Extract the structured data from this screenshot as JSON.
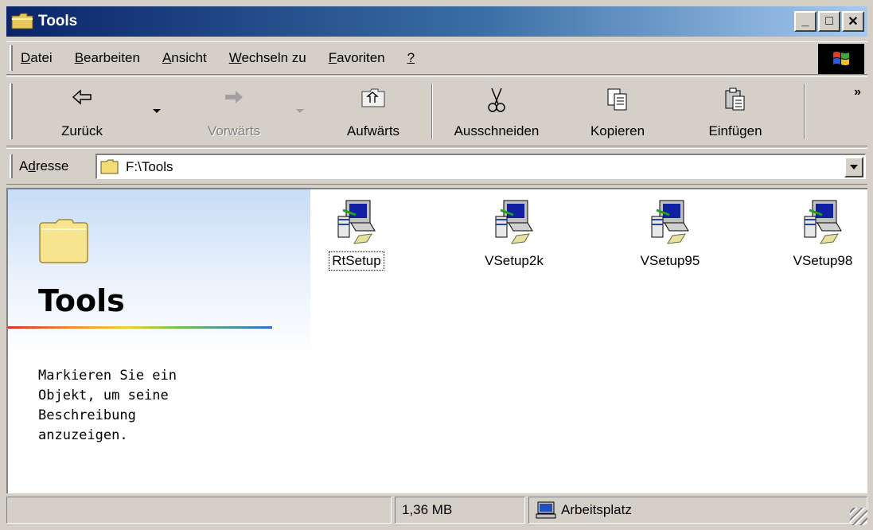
{
  "window": {
    "title": "Tools",
    "minimize": "_",
    "maximize": "□",
    "close": "✕"
  },
  "menu": {
    "items": [
      {
        "first": "D",
        "rest": "atei"
      },
      {
        "first": "B",
        "rest": "earbeiten"
      },
      {
        "first": "A",
        "rest": "nsicht"
      },
      {
        "first": "W",
        "rest": "echseln zu"
      },
      {
        "first": "F",
        "rest": "avoriten"
      },
      {
        "first": "?",
        "rest": ""
      }
    ]
  },
  "toolbar": {
    "back": "Zurück",
    "forward": "Vorwärts",
    "up": "Aufwärts",
    "cut": "Ausschneiden",
    "copy": "Kopieren",
    "paste": "Einfügen",
    "more": "»"
  },
  "address": {
    "label_pre": "A",
    "label_u": "d",
    "label_post": "resse",
    "value": "F:\\Tools"
  },
  "leftpane": {
    "title": "Tools",
    "description": "Markieren Sie ein\nObjekt, um seine\nBeschreibung\nanzuzeigen."
  },
  "files": [
    {
      "name": "RtSetup",
      "selected": true
    },
    {
      "name": "VSetup2k",
      "selected": false
    },
    {
      "name": "VSetup95",
      "selected": false
    },
    {
      "name": "VSetup98",
      "selected": false
    }
  ],
  "status": {
    "size": "1,36 MB",
    "zone": "Arbeitsplatz"
  },
  "colors": {
    "title_start": "#0a246a",
    "title_end": "#a6caf0",
    "face": "#d4d0c8"
  }
}
